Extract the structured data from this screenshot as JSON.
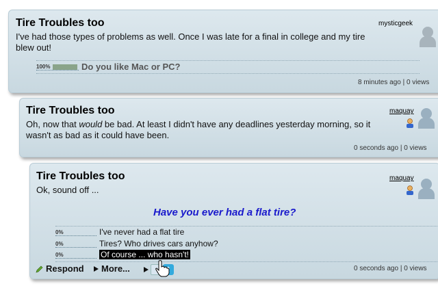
{
  "posts": [
    {
      "title": "Tire Troubles too",
      "author": "mysticgeek",
      "body": "I've had those types of problems as well. Once I was late for a final in college and my tire blew out!",
      "poll": {
        "percent": "100%",
        "question": "Do you like Mac or PC?"
      },
      "meta": "8 minutes ago | 0 views"
    },
    {
      "title": "Tire Troubles too",
      "author": "maquay",
      "body_before": "Oh, now that ",
      "body_em": "would",
      "body_after": " be bad.  At least I didn't have any deadlines yesterday morning, so it wasn't as bad as it could have been.",
      "meta": "0 seconds ago | 0 views"
    },
    {
      "title": "Tire Troubles too",
      "author": "maquay",
      "body": "Ok, sound off ...",
      "poll_question": "Have you ever had a flat tire?",
      "options": [
        {
          "percent": "0%",
          "label": "I've never had a flat tire"
        },
        {
          "percent": "0%",
          "label": "Tires? Who drives cars anyhow?"
        },
        {
          "percent": "0%",
          "label": "Of course ... who hasn't!"
        }
      ],
      "actions": {
        "respond": "Respond",
        "more": "More..."
      },
      "meta": "0 seconds ago | 0 views"
    }
  ],
  "icons": {
    "respond": "pencil-icon",
    "more": "triangle-right-icon",
    "share": "triangle-right-icon",
    "facebook": "facebook-icon",
    "twitter": "twitter-icon",
    "cursor": "hand-pointer-icon"
  },
  "colors": {
    "poll_question": "#1a1acc",
    "selected_option_bg": "#000000",
    "twitter": "#33aadd",
    "card_bg": "#d2e0e7"
  }
}
